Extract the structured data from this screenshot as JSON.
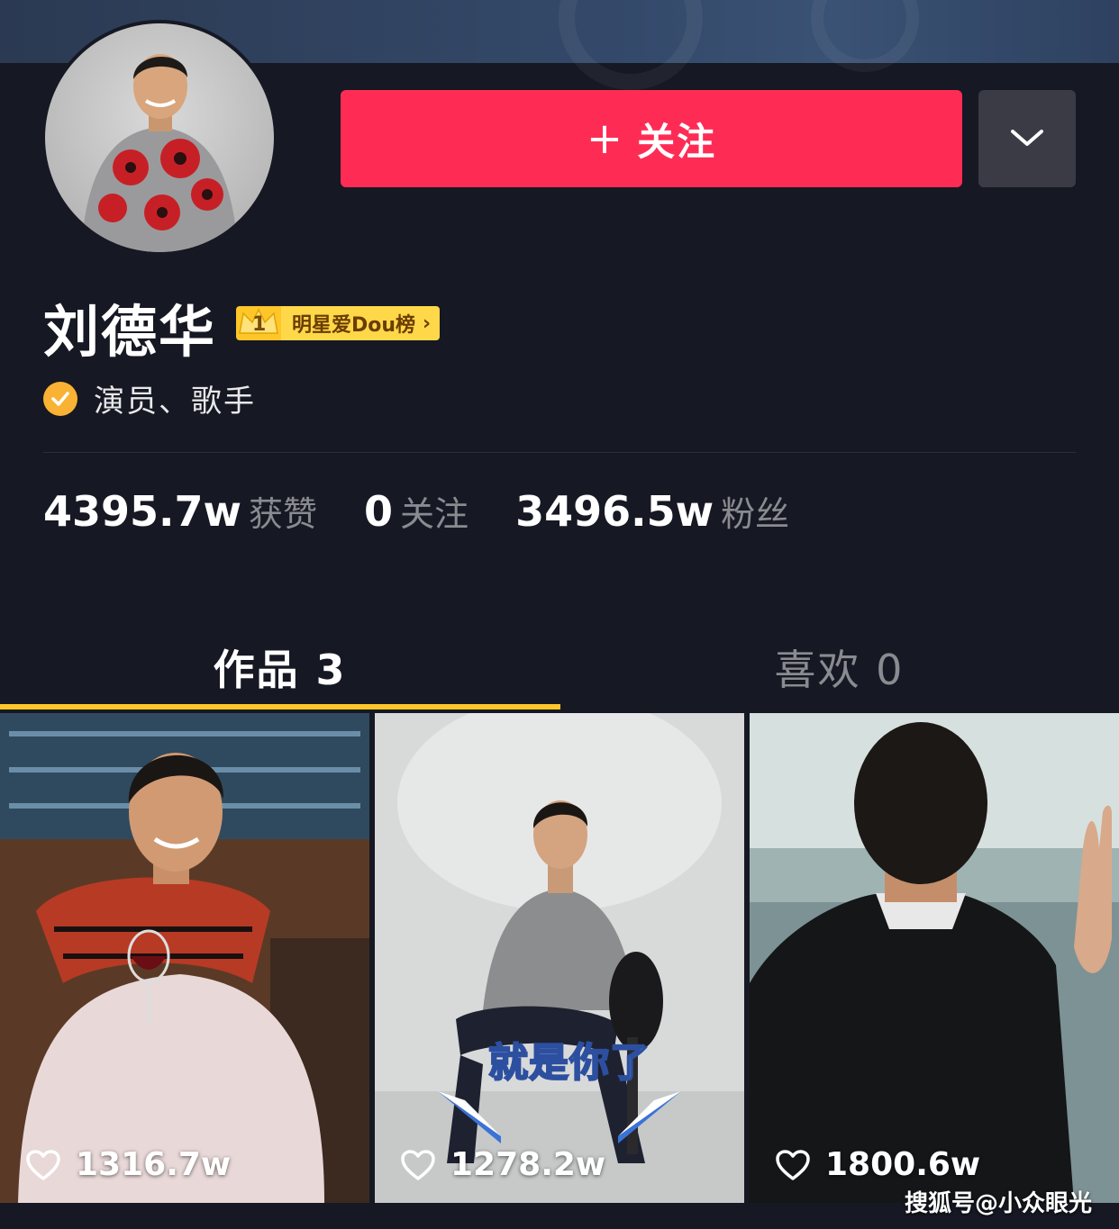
{
  "profile": {
    "name": "刘德华",
    "rank_number": "1",
    "rank_label": "明星爱Dou榜",
    "verified_text": "演员、歌手",
    "follow_label": "关注",
    "follow_plus": "+"
  },
  "stats": [
    {
      "value": "4395.7w",
      "label": "获赞"
    },
    {
      "value": "0",
      "label": "关注"
    },
    {
      "value": "3496.5w",
      "label": "粉丝"
    }
  ],
  "tabs": [
    {
      "label": "作品 3",
      "active": true
    },
    {
      "label": "喜欢 0",
      "active": false
    }
  ],
  "videos": [
    {
      "likes": "1316.7w"
    },
    {
      "likes": "1278.2w",
      "caption": "就是你了"
    },
    {
      "likes": "1800.6w"
    }
  ],
  "watermark": "搜狐号@小众眼光",
  "colors": {
    "background": "#161823",
    "follow_button": "#fe2c55",
    "accent_yellow": "#ffc62a",
    "verified": "#f9b233"
  },
  "icons": {
    "more": "chevron-down-icon",
    "verified": "check-circle-icon",
    "like": "heart-outline-icon"
  }
}
